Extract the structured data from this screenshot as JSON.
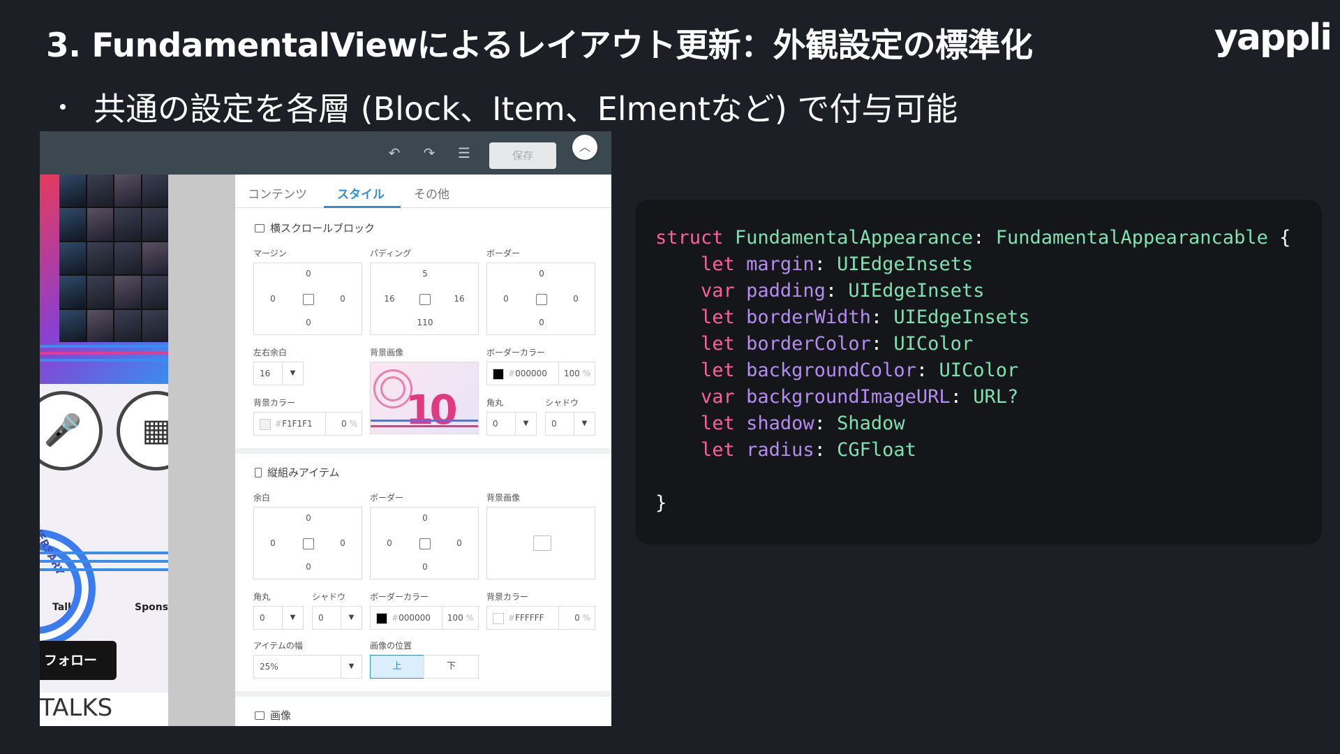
{
  "slide": {
    "title": "3. FundamentalViewによるレイアウト更新：外観設定の標準化",
    "logo": "yappli",
    "bullet": "共通の設定を各層 (Block、Item、Elmentなど) で付与可能"
  },
  "toolbar": {
    "undo_icon": "undo-icon",
    "redo_icon": "redo-icon",
    "settings_icon": "sliders-icon",
    "save_label": "保存",
    "collapse_icon": "chevron-up-icon"
  },
  "preview": {
    "talks_label": "Talks",
    "sponsor_label": "Sponso",
    "anniversary_text": "VERSARY",
    "follow_label": "フォロー",
    "talks_heading": "TALKS"
  },
  "tabs": [
    {
      "label": "コンテンツ"
    },
    {
      "label": "スタイル"
    },
    {
      "label": "その他"
    }
  ],
  "block_section": {
    "title": "横スクロールブロック",
    "margin": {
      "label": "マージン",
      "top": "0",
      "left": "0",
      "right": "0",
      "bottom": "0"
    },
    "padding": {
      "label": "パディング",
      "top": "5",
      "left": "16",
      "right": "16",
      "bottom": "110"
    },
    "border": {
      "label": "ボーダー",
      "top": "0",
      "left": "0",
      "right": "0",
      "bottom": "0"
    },
    "side_margin": {
      "label": "左右余白",
      "value": "16"
    },
    "bg_image": {
      "label": "背景画像"
    },
    "border_color": {
      "label": "ボーダーカラー",
      "hash": "#",
      "hex": "000000",
      "opacity": "100",
      "pct": "%",
      "swatch": "#000000"
    },
    "bg_color": {
      "label": "背景カラー",
      "hash": "#",
      "hex": "F1F1F1",
      "opacity": "0",
      "pct": "%",
      "swatch": "#f1f1f1"
    },
    "radius": {
      "label": "角丸",
      "value": "0"
    },
    "shadow": {
      "label": "シャドウ",
      "value": "0"
    }
  },
  "item_section": {
    "title": "縦組みアイテム",
    "spacing": {
      "label": "余白",
      "top": "0",
      "left": "0",
      "right": "0",
      "bottom": "0"
    },
    "border": {
      "label": "ボーダー",
      "top": "0",
      "left": "0",
      "right": "0",
      "bottom": "0"
    },
    "bg_image": {
      "label": "背景画像"
    },
    "radius": {
      "label": "角丸",
      "value": "0"
    },
    "shadow": {
      "label": "シャドウ",
      "value": "0"
    },
    "border_color": {
      "label": "ボーダーカラー",
      "hash": "#",
      "hex": "000000",
      "opacity": "100",
      "pct": "%",
      "swatch": "#000000"
    },
    "bg_color": {
      "label": "背景カラー",
      "hash": "#",
      "hex": "FFFFFF",
      "opacity": "0",
      "pct": "%",
      "swatch": "#ffffff"
    },
    "item_width": {
      "label": "アイテムの幅",
      "value": "25%"
    },
    "image_position": {
      "label": "画像の位置",
      "top_label": "上",
      "bottom_label": "下"
    }
  },
  "image_section": {
    "title": "画像"
  },
  "code": {
    "struct_kw": "struct",
    "struct_name": "FundamentalAppearance",
    "protocol": "FundamentalAppearancable",
    "open_brace": "{",
    "close_brace": "}",
    "lines": [
      {
        "kw": "let",
        "name": "margin",
        "type": "UIEdgeInsets"
      },
      {
        "kw": "var",
        "name": "padding",
        "type": "UIEdgeInsets"
      },
      {
        "kw": "let",
        "name": "borderWidth",
        "type": "UIEdgeInsets"
      },
      {
        "kw": "let",
        "name": "borderColor",
        "type": "UIColor"
      },
      {
        "kw": "let",
        "name": "backgroundColor",
        "type": "UIColor"
      },
      {
        "kw": "var",
        "name": "backgroundImageURL",
        "type": "URL?"
      },
      {
        "kw": "let",
        "name": "shadow",
        "type": "Shadow"
      },
      {
        "kw": "let",
        "name": "radius",
        "type": "CGFloat"
      }
    ]
  },
  "colors": {
    "slide_bg": "#1d1f26",
    "accent_blue": "#2f8fd5",
    "code_keyword": "#ff5f9e",
    "code_type": "#7ee3b0",
    "code_identifier": "#b48cf2"
  }
}
